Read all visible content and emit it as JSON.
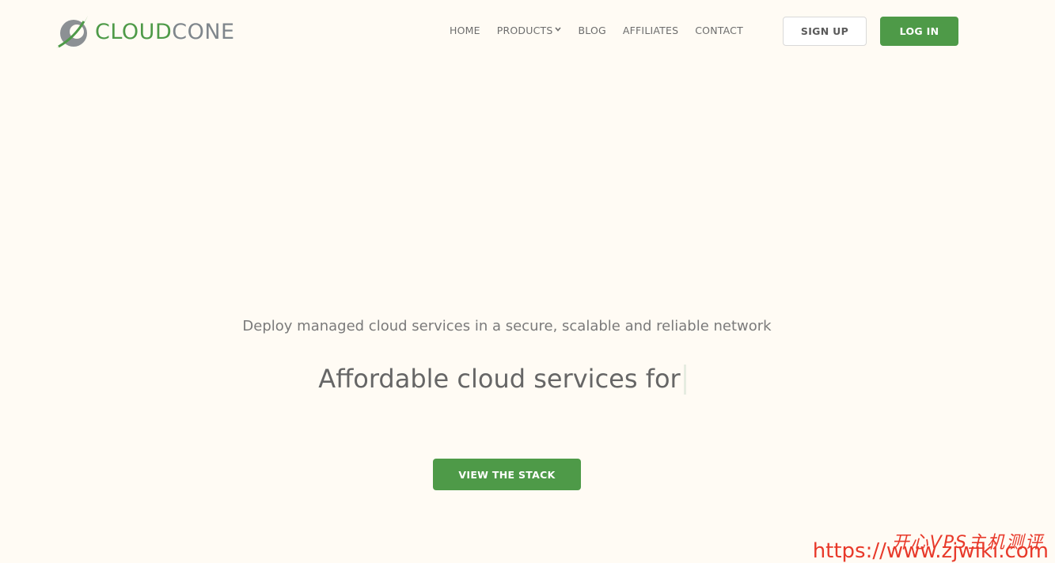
{
  "header": {
    "logo": {
      "text_part1": "CLOUD",
      "text_part2": "CONE",
      "colors": {
        "green": "#4e9a48",
        "gray": "#7f868c"
      }
    },
    "nav": {
      "items": [
        {
          "label": "HOME"
        },
        {
          "label": "PRODUCTS",
          "has_dropdown": true,
          "icon": "chevron-down-icon"
        },
        {
          "label": "BLOG"
        },
        {
          "label": "AFFILIATES"
        },
        {
          "label": "CONTACT"
        }
      ]
    },
    "signup_label": "SIGN UP",
    "login_label": "LOG IN"
  },
  "hero": {
    "subtitle": "Deploy managed cloud services in a secure, scalable and reliable network",
    "title": "Affordable cloud services for",
    "cta_label": "VIEW THE STACK"
  },
  "watermark": {
    "url": "https://www.zjwiki.com",
    "cn_text": "开心VPS主机测评"
  },
  "colors": {
    "background": "#fffbf4",
    "accent": "#4e9a48",
    "text": "#666666",
    "watermark": "#e8392a"
  }
}
